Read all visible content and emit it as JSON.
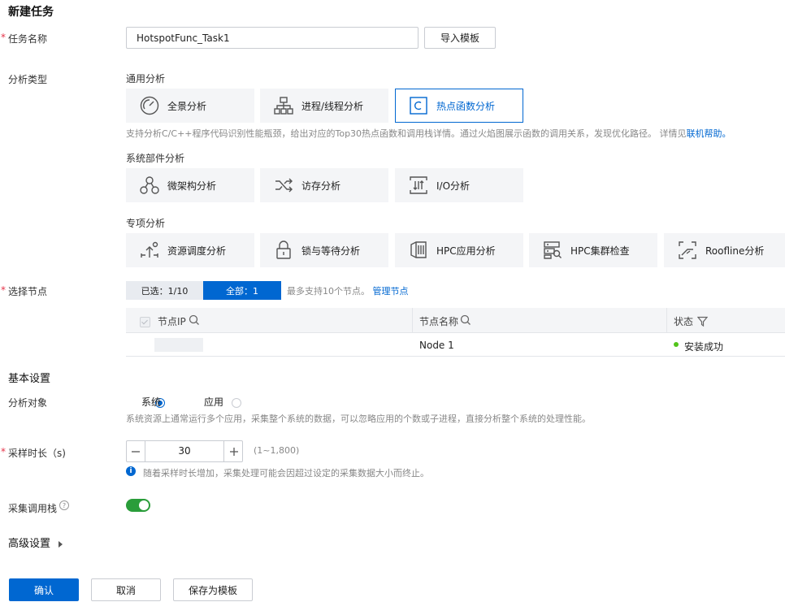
{
  "page": {
    "title": "新建任务"
  },
  "task_name": {
    "label": "任务名称",
    "value": "HotspotFunc_Task1",
    "import_button": "导入模板"
  },
  "analysis_type": {
    "label": "分析类型",
    "general": {
      "title": "通用分析",
      "items": [
        {
          "label": "全景分析",
          "icon": "gauge-icon"
        },
        {
          "label": "进程/线程分析",
          "icon": "process-tree-icon"
        },
        {
          "label": "热点函数分析",
          "icon": "function-c-icon",
          "selected": true
        }
      ],
      "description": "支持分析C/C++程序代码识别性能瓶颈，给出对应的Top30热点函数和调用栈详情。通过火焰图展示函数的调用关系，发现优化路径。 详情见",
      "help_link": "联机帮助。"
    },
    "system": {
      "title": "系统部件分析",
      "items": [
        {
          "label": "微架构分析",
          "icon": "microarch-icon"
        },
        {
          "label": "访存分析",
          "icon": "shuffle-icon"
        },
        {
          "label": "I/O分析",
          "icon": "io-icon"
        }
      ]
    },
    "special": {
      "title": "专项分析",
      "items": [
        {
          "label": "资源调度分析",
          "icon": "schedule-icon"
        },
        {
          "label": "锁与等待分析",
          "icon": "lock-icon"
        },
        {
          "label": "HPC应用分析",
          "icon": "hpc-app-icon"
        },
        {
          "label": "HPC集群检查",
          "icon": "cluster-check-icon"
        },
        {
          "label": "Roofline分析",
          "icon": "roofline-icon"
        }
      ]
    }
  },
  "node_select": {
    "label": "选择节点",
    "selected_tab": "已选：1/10",
    "all_tab": "全部：1",
    "hint": "最多支持10个节点。",
    "manage_link": "管理节点",
    "columns": [
      "节点IP",
      "节点名称",
      "状态"
    ],
    "rows": [
      {
        "ip": "",
        "name": "Node 1",
        "status": "安装成功"
      }
    ],
    "status_color": "#52c41a"
  },
  "basic": {
    "title": "基本设置",
    "target_label": "分析对象",
    "opt_system": "系统",
    "opt_app": "应用",
    "target_desc": "系统资源上通常运行多个应用，采集整个系统的数据，可以忽略应用的个数或子进程，直接分析整个系统的处理性能。",
    "duration_label": "采样时长（s)",
    "duration_value": "30",
    "duration_range": "(1~1,800)",
    "duration_tip": "随着采样时长增加，采集处理可能会因超过设定的采集数据大小而终止。",
    "callstack_label": "采集调用栈",
    "callstack_on": true
  },
  "advanced": {
    "title": "高级设置"
  },
  "actions": {
    "confirm": "确认",
    "cancel": "取消",
    "save_template": "保存为模板"
  },
  "colors": {
    "accent": "#0067d1",
    "required": "#e5344a",
    "toggle": "#2a9d3a"
  }
}
